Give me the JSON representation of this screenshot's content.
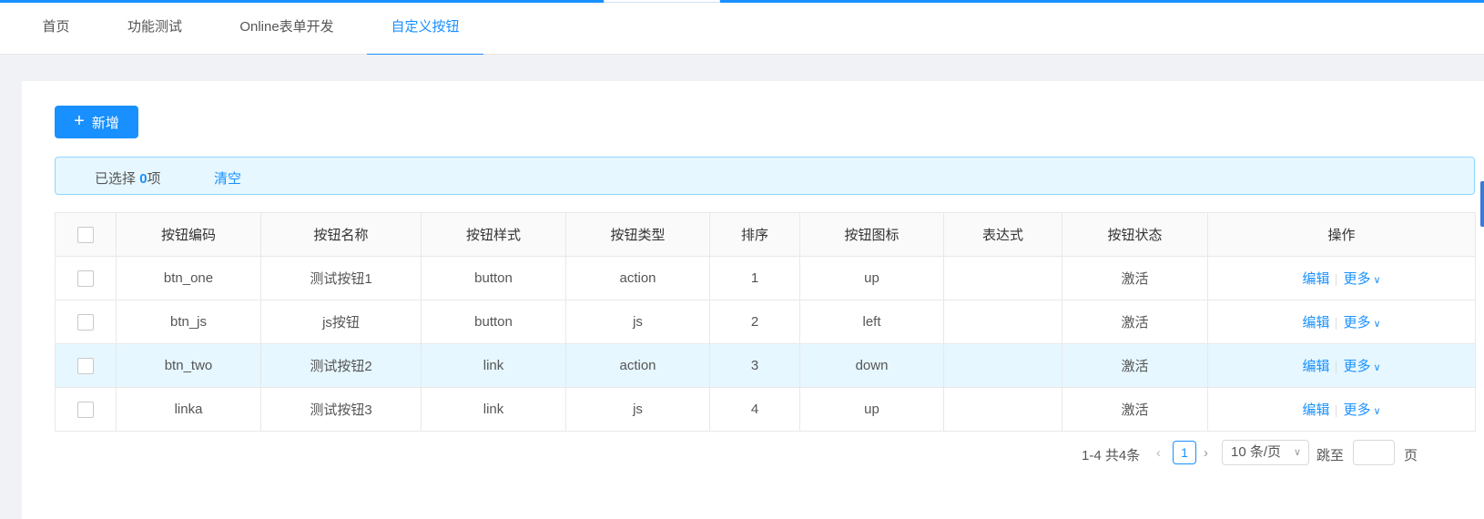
{
  "tabs": [
    {
      "label": "首页"
    },
    {
      "label": "功能测试"
    },
    {
      "label": "Online表单开发"
    },
    {
      "label": "自定义按钮"
    }
  ],
  "toolbar": {
    "add_label": "新增",
    "add_icon": "plus-icon"
  },
  "alert": {
    "selected_prefix": "已选择",
    "selected_count": "0",
    "selected_suffix": "项",
    "clear_label": "清空"
  },
  "table": {
    "columns": [
      "按钮编码",
      "按钮名称",
      "按钮样式",
      "按钮类型",
      "排序",
      "按钮图标",
      "表达式",
      "按钮状态",
      "操作"
    ],
    "rows": [
      {
        "code": "btn_one",
        "name": "测试按钮1",
        "style": "button",
        "type": "action",
        "order": "1",
        "icon": "up",
        "expr": "",
        "status": "激活",
        "edit": "编辑",
        "more": "更多"
      },
      {
        "code": "btn_js",
        "name": "js按钮",
        "style": "button",
        "type": "js",
        "order": "2",
        "icon": "left",
        "expr": "",
        "status": "激活",
        "edit": "编辑",
        "more": "更多"
      },
      {
        "code": "btn_two",
        "name": "测试按钮2",
        "style": "link",
        "type": "action",
        "order": "3",
        "icon": "down",
        "expr": "",
        "status": "激活",
        "edit": "编辑",
        "more": "更多"
      },
      {
        "code": "linka",
        "name": "测试按钮3",
        "style": "link",
        "type": "js",
        "order": "4",
        "icon": "up",
        "expr": "",
        "status": "激活",
        "edit": "编辑",
        "more": "更多"
      }
    ],
    "highlighted_row": 2
  },
  "pagination": {
    "total": "1-4 共4条",
    "current": "1",
    "page_size": "10 条/页",
    "goto_label": "跳至",
    "page_label": "页"
  },
  "colors": {
    "accent": "#1890ff",
    "highlight_row": "#e6f7ff"
  }
}
